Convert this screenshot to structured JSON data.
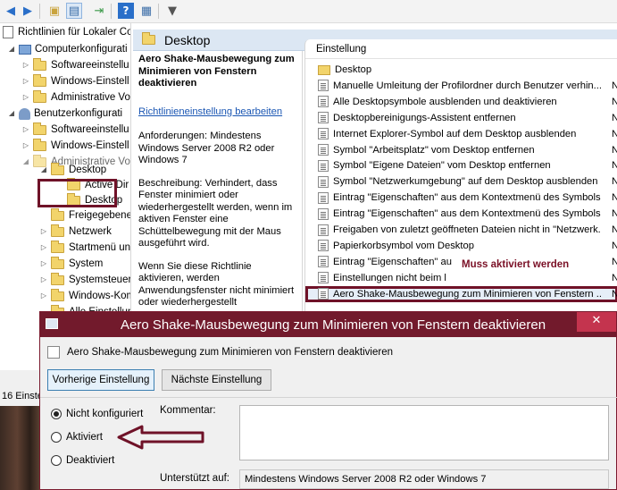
{
  "toolbar": {
    "icons": [
      "back-icon",
      "forward-icon",
      "up-folder-icon",
      "show-hide-tree-icon",
      "export-list-icon",
      "help-icon",
      "properties-icon",
      "filter-icon"
    ]
  },
  "tree": {
    "root": "Richtlinien für Lokaler Co",
    "computer": "Computerkonfigurati",
    "computer_children": [
      "Softwareeinstellu",
      "Windows-Einstell",
      "Administrative Vo"
    ],
    "user": "Benutzerkonfigurati",
    "user_children": [
      "Softwareeinstellu",
      "Windows-Einstell",
      "Administrative Vo"
    ],
    "desktop": "Desktop",
    "desktop_children": [
      "Active Dir",
      "Desktop"
    ],
    "more": [
      "Freigegebene",
      "Netzwerk",
      "Startmenü un",
      "System",
      "Systemsteuer",
      "Windows-Kom",
      "Alle Einstellung"
    ]
  },
  "status": {
    "count": "16 Einste"
  },
  "header": {
    "title": "Desktop"
  },
  "description": {
    "title": "Aero Shake-Mausbewegung zum Minimieren von Fenstern deaktivieren",
    "link": "Richtlinieneinstellung bearbeiten",
    "requirements": "Anforderungen: Mindestens Windows Server 2008 R2 oder Windows 7",
    "description_text": "Beschreibung: Verhindert, dass Fenster minimiert oder wiederhergestellt werden, wenn im aktiven Fenster eine Schüttelbewegung mit der Maus ausgeführt wird.",
    "extra": "Wenn Sie diese Richtlinie aktivieren, werden Anwendungsfenster nicht minimiert oder wiederhergestellt"
  },
  "list": {
    "column": "Einstellung",
    "rows": [
      {
        "text": "Desktop",
        "state": "",
        "folder": true
      },
      {
        "text": "Manuelle Umleitung der Profilordner durch Benutzer verhin...",
        "state": "N"
      },
      {
        "text": "Alle Desktopsymbole ausblenden und deaktivieren",
        "state": "N"
      },
      {
        "text": "Desktopbereinigungs-Assistent entfernen",
        "state": "N"
      },
      {
        "text": "Internet Explorer-Symbol auf dem Desktop ausblenden",
        "state": "N"
      },
      {
        "text": "Symbol \"Arbeitsplatz\" vom Desktop entfernen",
        "state": "N"
      },
      {
        "text": "Symbol \"Eigene Dateien\" vom Desktop entfernen",
        "state": "N"
      },
      {
        "text": "Symbol \"Netzwerkumgebung\" auf dem Desktop ausblenden",
        "state": "N"
      },
      {
        "text": "Eintrag \"Eigenschaften\" aus dem Kontextmenü des Symbols...",
        "state": "N"
      },
      {
        "text": "Eintrag \"Eigenschaften\" aus dem Kontextmenü des Symbols...",
        "state": "N"
      },
      {
        "text": "Freigaben von zuletzt geöffneten Dateien nicht in \"Netzwerk...",
        "state": "N"
      },
      {
        "text": "Papierkorbsymbol vom Desktop",
        "state": "N"
      },
      {
        "text": "Eintrag \"Eigenschaften\" au",
        "state": "N"
      },
      {
        "text": "Einstellungen nicht beim l",
        "state": "N"
      },
      {
        "text": "Aero Shake-Mausbewegung zum Minimieren von Fenstern ...",
        "state": "N",
        "selected": true
      }
    ],
    "annotation": "Muss aktiviert werden"
  },
  "dialog": {
    "title": "Aero Shake-Mausbewegung zum Minimieren von Fenstern deaktivieren",
    "subtitle": "Aero Shake-Mausbewegung zum Minimieren von Fenstern deaktivieren",
    "prev_button": "Vorherige Einstellung",
    "next_button": "Nächste Einstellung",
    "options": [
      "Nicht konfiguriert",
      "Aktiviert",
      "Deaktiviert"
    ],
    "selected_option": "Nicht konfiguriert",
    "comment_label": "Kommentar:",
    "supported_label": "Unterstützt auf:",
    "supported_value": "Mindestens Windows Server 2008 R2 oder Windows 7",
    "close_glyph": "✕"
  },
  "colors": {
    "highlight": "#6f1228",
    "title_bar": "#721a2c",
    "link": "#1a56b3"
  }
}
